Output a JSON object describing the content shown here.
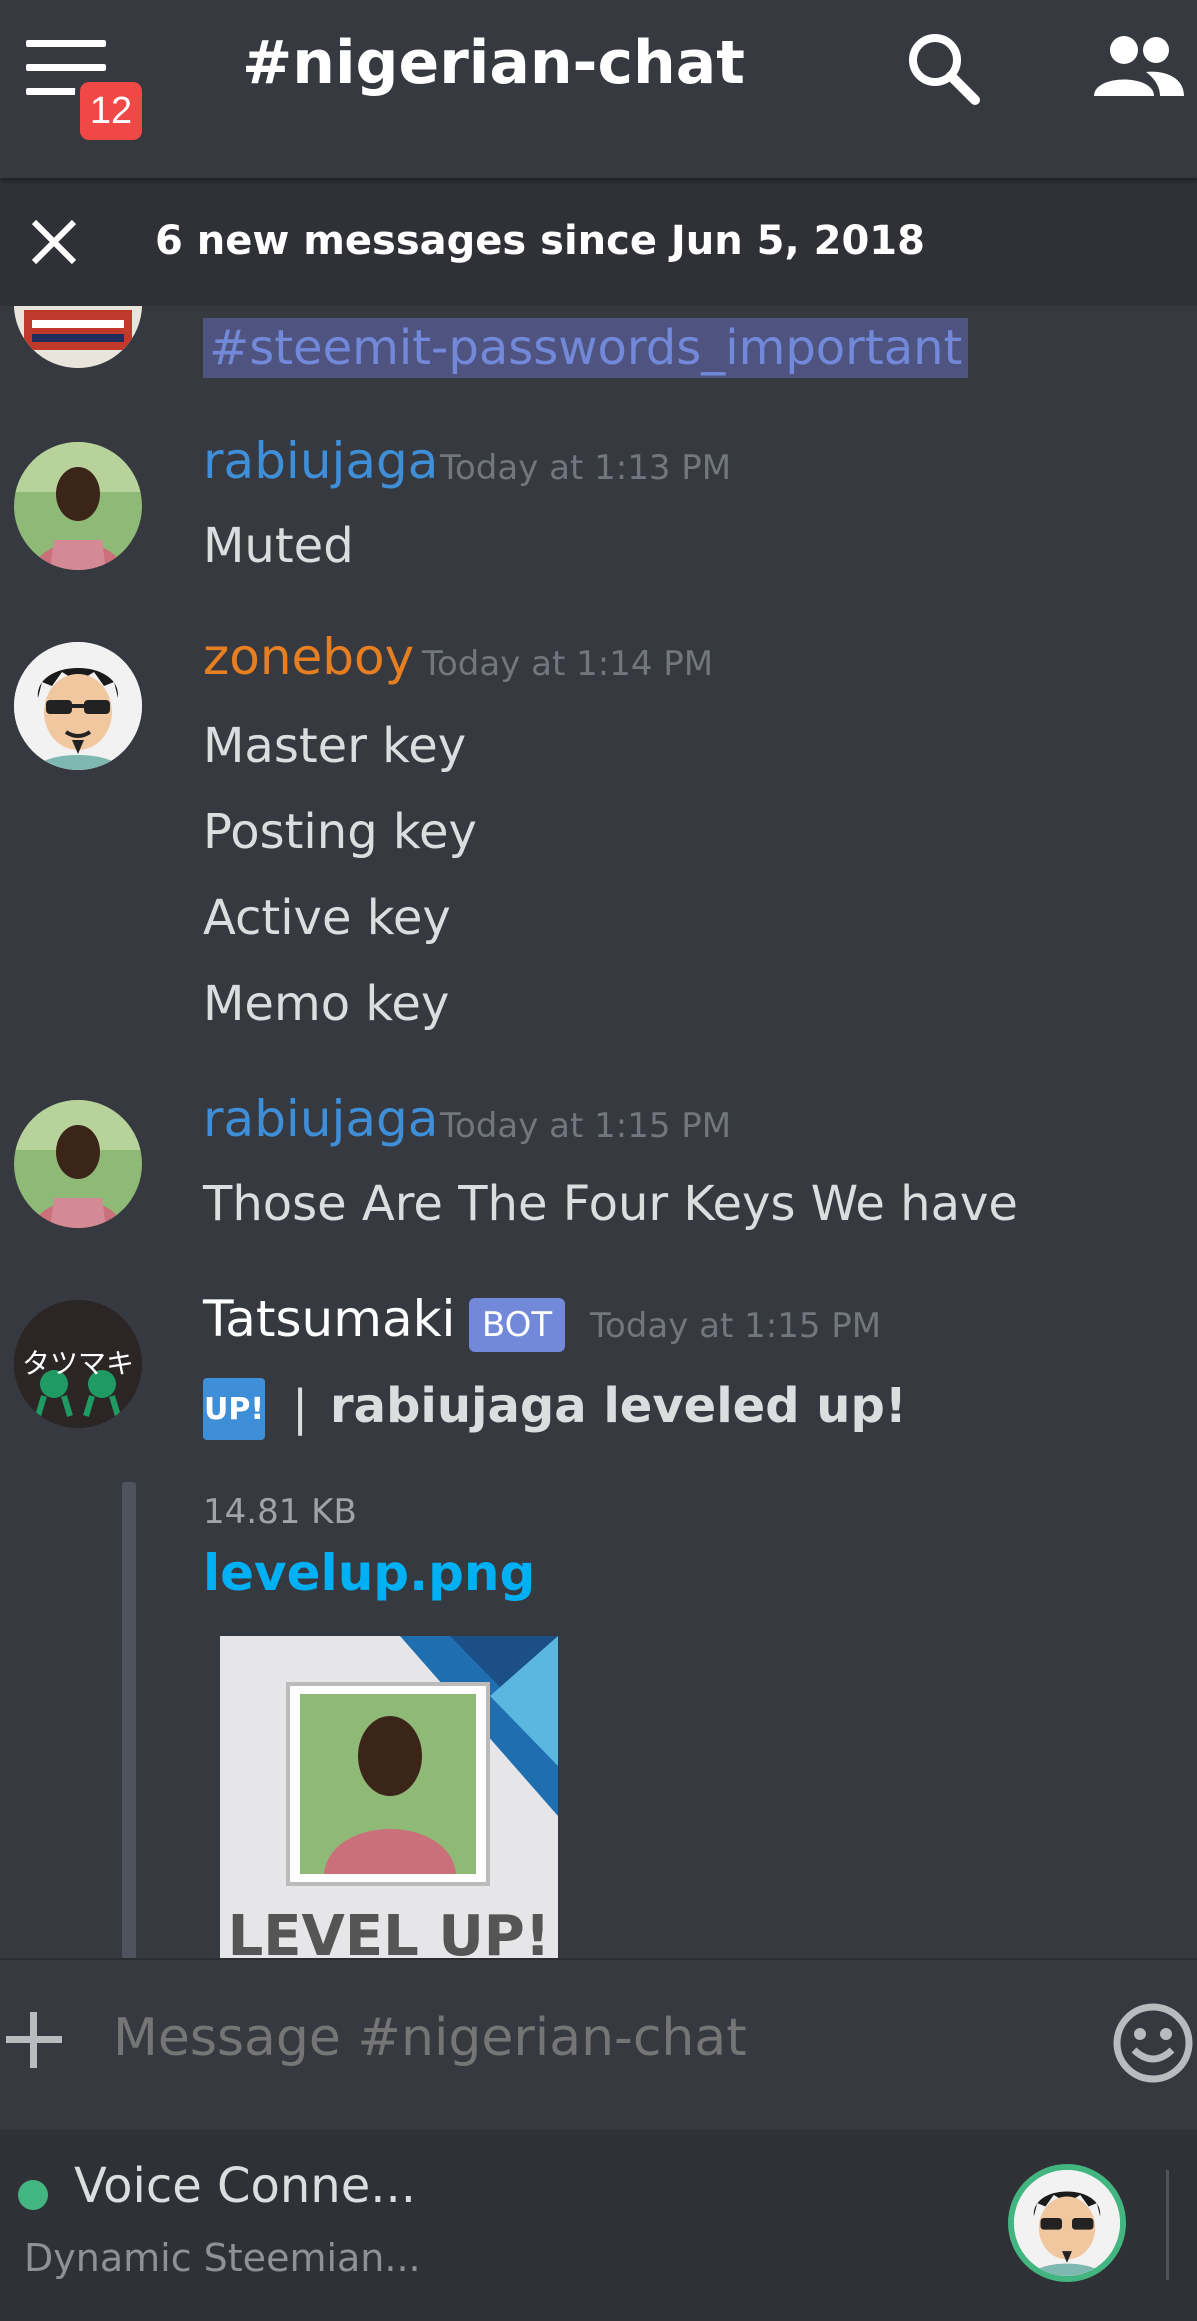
{
  "header": {
    "channel_title": "#nigerian-chat",
    "unread_badge": "12",
    "menu_icon": "hamburger-menu-icon",
    "search_icon": "search-icon",
    "members_icon": "members-icon"
  },
  "notice": {
    "text": "6 new messages since Jun 5, 2018",
    "close_icon": "close-icon"
  },
  "messages": [
    {
      "type": "continuation",
      "channel_link": "#steemit-passwords_important"
    },
    {
      "author": "rabiujaga",
      "author_color": "#3f8ed8",
      "timestamp": "Today at 1:13 PM",
      "lines": [
        "Muted"
      ]
    },
    {
      "author": "zoneboy",
      "author_color": "#e67e22",
      "timestamp": "Today at 1:14 PM",
      "lines": [
        "Master key",
        "Posting key",
        "Active key",
        "Memo key"
      ]
    },
    {
      "author": "rabiujaga",
      "author_color": "#3f8ed8",
      "timestamp": "Today at 1:15 PM",
      "lines": [
        "Those Are The Four Keys We have"
      ]
    },
    {
      "author": "Tatsumaki",
      "author_color": "#ffffff",
      "bot_tag": "BOT",
      "timestamp": "Today at 1:15 PM",
      "up_badge": "UP!",
      "separator": "|",
      "text": "rabiujaga leveled up!",
      "avatar_text": "タツマキ",
      "attachment": {
        "size": "14.81 KB",
        "filename": "levelup.png",
        "image_caption": "LEVEL UP!"
      }
    }
  ],
  "composer": {
    "placeholder": "Message #nigerian-chat",
    "add_icon": "plus-icon",
    "emoji_icon": "emoji-icon"
  },
  "voice": {
    "status": "Voice Conne...",
    "channel": "Dynamic Steemian...",
    "status_color": "#43b581"
  },
  "colors": {
    "background": "#36393f",
    "notice_bg": "#2f3136",
    "link": "#00b0f4",
    "blurple": "#7289da",
    "badge_red": "#f04747"
  }
}
